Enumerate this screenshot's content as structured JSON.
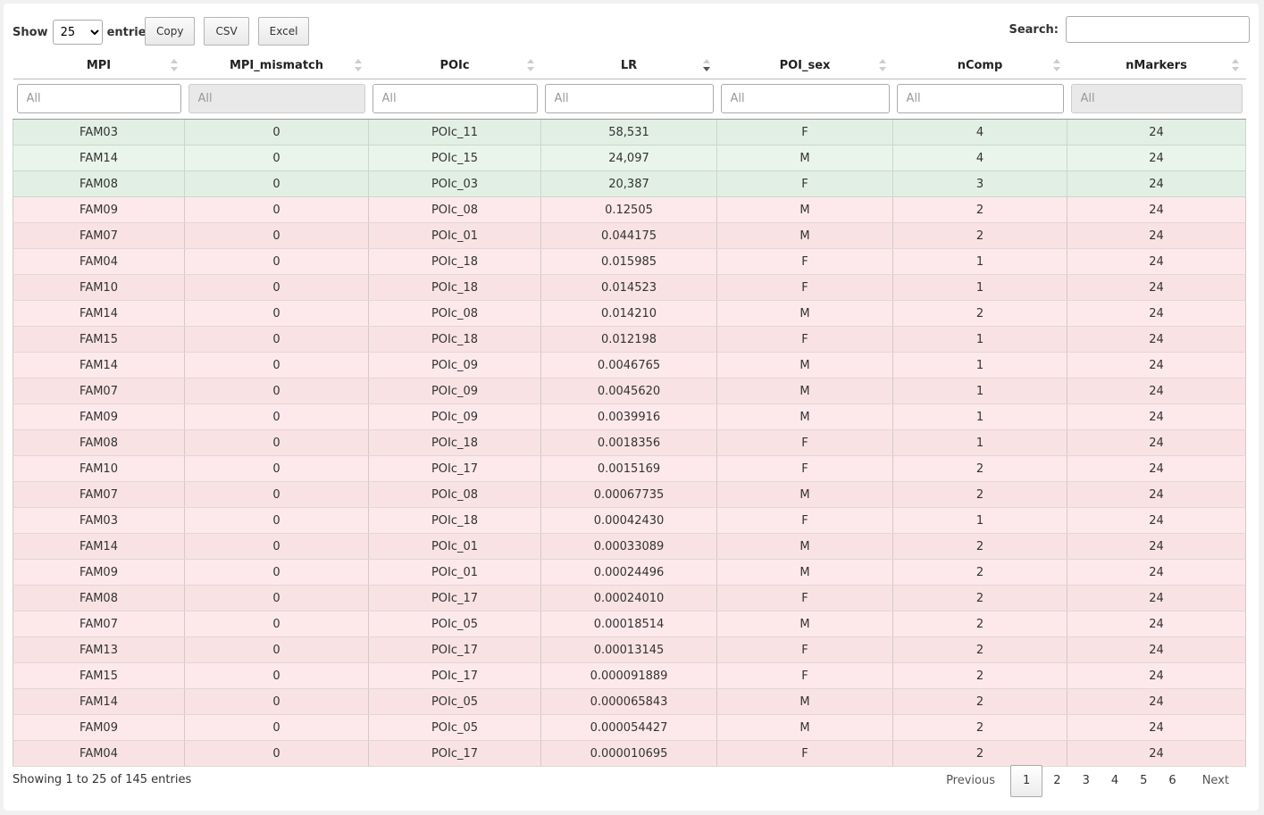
{
  "length": {
    "label_show": "Show",
    "selected": "25",
    "label_entries": "entries"
  },
  "buttons": {
    "copy": "Copy",
    "csv": "CSV",
    "excel": "Excel"
  },
  "search": {
    "label": "Search:",
    "value": ""
  },
  "columns": [
    "MPI",
    "MPI_mismatch",
    "POIc",
    "LR",
    "POI_sex",
    "nComp",
    "nMarkers"
  ],
  "sort": {
    "column": "LR",
    "direction": "desc"
  },
  "filter_placeholder": "All",
  "rows": [
    [
      "FAM03",
      "0",
      "POIc_11",
      "58,531",
      "F",
      "4",
      "24"
    ],
    [
      "FAM14",
      "0",
      "POIc_15",
      "24,097",
      "M",
      "4",
      "24"
    ],
    [
      "FAM08",
      "0",
      "POIc_03",
      "20,387",
      "F",
      "3",
      "24"
    ],
    [
      "FAM09",
      "0",
      "POIc_08",
      "0.12505",
      "M",
      "2",
      "24"
    ],
    [
      "FAM07",
      "0",
      "POIc_01",
      "0.044175",
      "M",
      "2",
      "24"
    ],
    [
      "FAM04",
      "0",
      "POIc_18",
      "0.015985",
      "F",
      "1",
      "24"
    ],
    [
      "FAM10",
      "0",
      "POIc_18",
      "0.014523",
      "F",
      "1",
      "24"
    ],
    [
      "FAM14",
      "0",
      "POIc_08",
      "0.014210",
      "M",
      "2",
      "24"
    ],
    [
      "FAM15",
      "0",
      "POIc_18",
      "0.012198",
      "F",
      "1",
      "24"
    ],
    [
      "FAM14",
      "0",
      "POIc_09",
      "0.0046765",
      "M",
      "1",
      "24"
    ],
    [
      "FAM07",
      "0",
      "POIc_09",
      "0.0045620",
      "M",
      "1",
      "24"
    ],
    [
      "FAM09",
      "0",
      "POIc_09",
      "0.0039916",
      "M",
      "1",
      "24"
    ],
    [
      "FAM08",
      "0",
      "POIc_18",
      "0.0018356",
      "F",
      "1",
      "24"
    ],
    [
      "FAM10",
      "0",
      "POIc_17",
      "0.0015169",
      "F",
      "2",
      "24"
    ],
    [
      "FAM07",
      "0",
      "POIc_08",
      "0.00067735",
      "M",
      "2",
      "24"
    ],
    [
      "FAM03",
      "0",
      "POIc_18",
      "0.00042430",
      "F",
      "1",
      "24"
    ],
    [
      "FAM14",
      "0",
      "POIc_01",
      "0.00033089",
      "M",
      "2",
      "24"
    ],
    [
      "FAM09",
      "0",
      "POIc_01",
      "0.00024496",
      "M",
      "2",
      "24"
    ],
    [
      "FAM08",
      "0",
      "POIc_17",
      "0.00024010",
      "F",
      "2",
      "24"
    ],
    [
      "FAM07",
      "0",
      "POIc_05",
      "0.00018514",
      "M",
      "2",
      "24"
    ],
    [
      "FAM13",
      "0",
      "POIc_17",
      "0.00013145",
      "F",
      "2",
      "24"
    ],
    [
      "FAM15",
      "0",
      "POIc_17",
      "0.000091889",
      "F",
      "2",
      "24"
    ],
    [
      "FAM14",
      "0",
      "POIc_05",
      "0.000065843",
      "M",
      "2",
      "24"
    ],
    [
      "FAM09",
      "0",
      "POIc_05",
      "0.000054427",
      "M",
      "2",
      "24"
    ],
    [
      "FAM04",
      "0",
      "POIc_17",
      "0.000010695",
      "F",
      "2",
      "24"
    ]
  ],
  "highlight_rows": 3,
  "colors": {
    "match_row": "#e2efe5",
    "mismatch_row": "#f8e2e4"
  },
  "info": "Showing 1 to 25 of 145 entries",
  "pagination": {
    "previous": "Previous",
    "next": "Next",
    "pages": [
      "1",
      "2",
      "3",
      "4",
      "5",
      "6"
    ],
    "current": "1"
  }
}
